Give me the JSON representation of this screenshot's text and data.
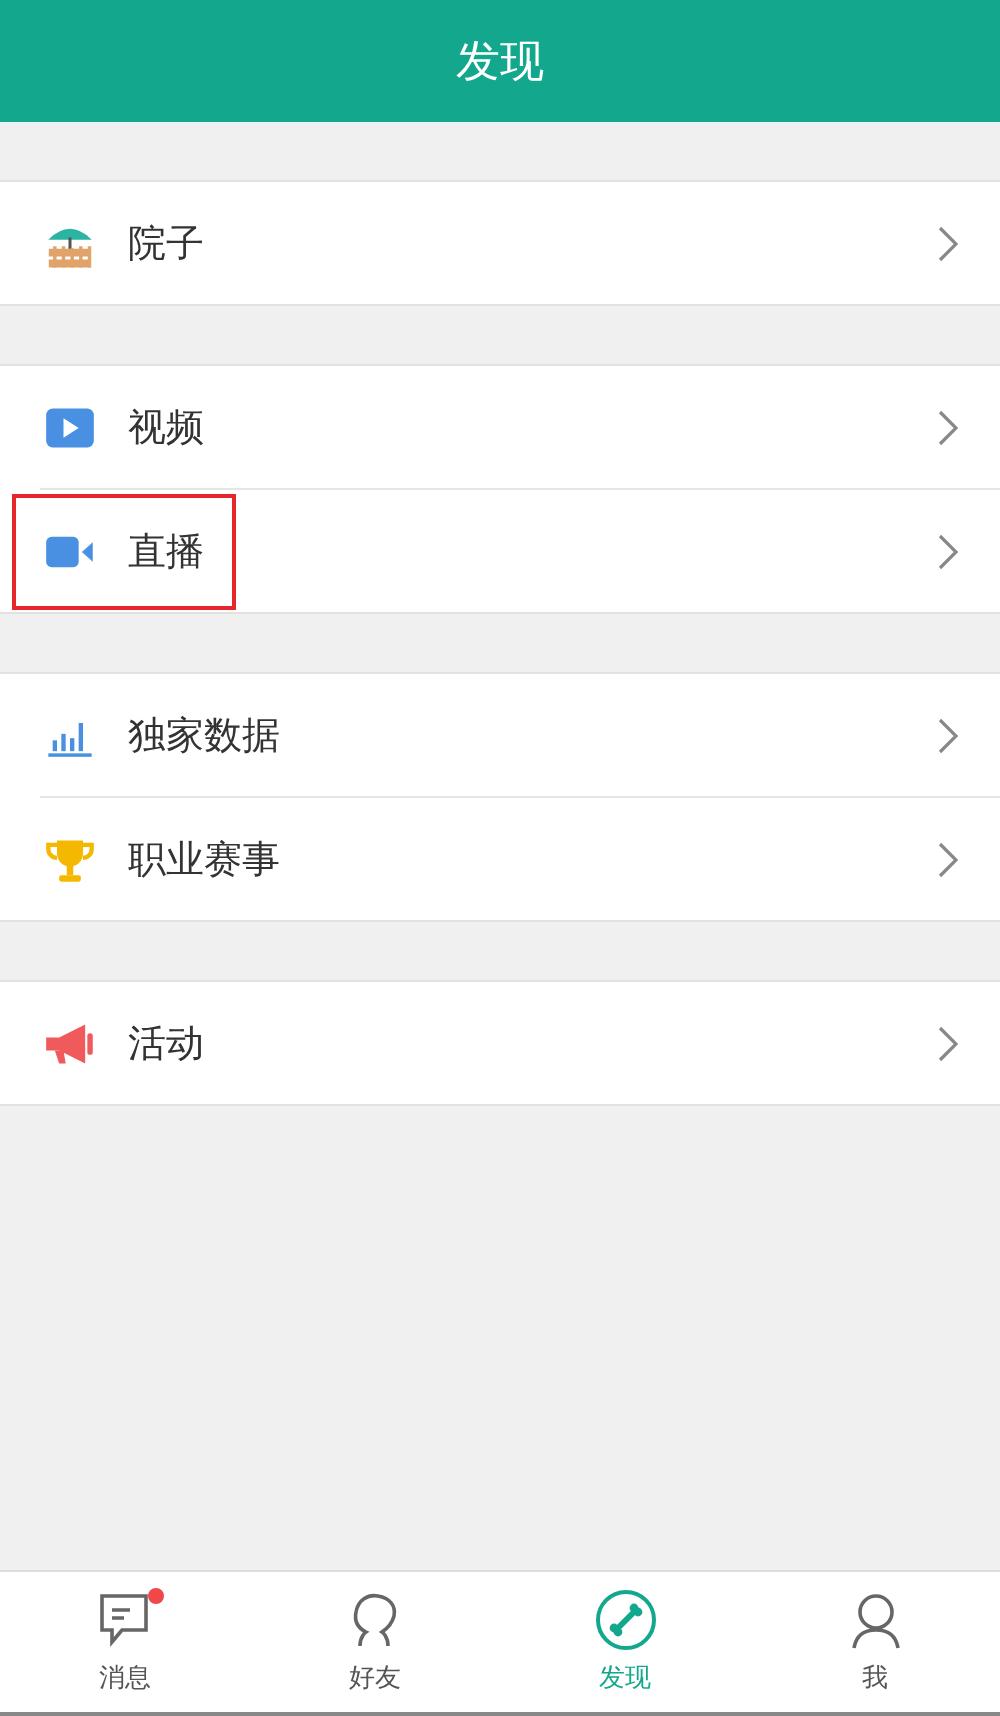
{
  "header": {
    "title": "发现"
  },
  "groups": [
    {
      "items": [
        {
          "kind": "yard",
          "label": "院子",
          "highlighted": false
        }
      ]
    },
    {
      "items": [
        {
          "kind": "video",
          "label": "视频",
          "highlighted": false
        },
        {
          "kind": "live",
          "label": "直播",
          "highlighted": true
        }
      ]
    },
    {
      "items": [
        {
          "kind": "data",
          "label": "独家数据",
          "highlighted": false
        },
        {
          "kind": "match",
          "label": "职业赛事",
          "highlighted": false
        }
      ]
    },
    {
      "items": [
        {
          "kind": "event",
          "label": "活动",
          "highlighted": false
        }
      ]
    }
  ],
  "tabs": [
    {
      "kind": "messages",
      "label": "消息",
      "selected": false,
      "badge": true
    },
    {
      "kind": "friends",
      "label": "好友",
      "selected": false,
      "badge": false
    },
    {
      "kind": "discover",
      "label": "发现",
      "selected": true,
      "badge": false
    },
    {
      "kind": "me",
      "label": "我",
      "selected": false,
      "badge": false
    }
  ]
}
